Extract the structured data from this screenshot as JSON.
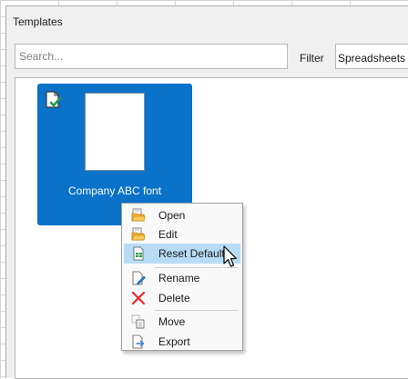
{
  "dialog": {
    "title": "Templates",
    "search": {
      "placeholder": "Search...",
      "value": ""
    },
    "filter": {
      "label": "Filter",
      "selected": "Spreadsheets"
    }
  },
  "templates": [
    {
      "name": "Company ABC font",
      "selected": true,
      "default": true
    }
  ],
  "context_menu": {
    "items": [
      {
        "label": "Open",
        "icon": "open-folder-icon"
      },
      {
        "label": "Edit",
        "icon": "edit-folder-icon"
      },
      {
        "label": "Reset Default",
        "icon": "reset-default-icon",
        "highlighted": true
      },
      {
        "label": "Rename",
        "icon": "rename-icon"
      },
      {
        "label": "Delete",
        "icon": "delete-icon"
      },
      {
        "label": "Move",
        "icon": "move-icon"
      },
      {
        "label": "Export",
        "icon": "export-icon"
      }
    ]
  },
  "colors": {
    "selection": "#0a72c8",
    "menu_highlight": "#b8dcf6",
    "delete_red": "#e0282c"
  }
}
